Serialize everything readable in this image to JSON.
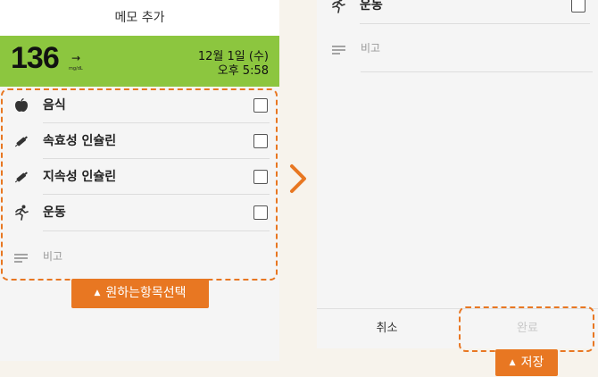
{
  "left_screen": {
    "title": "메모 추가",
    "glucose": {
      "value": "136",
      "trend_arrow": "→",
      "unit": "mg/dL"
    },
    "date": "12월 1일 (수)",
    "time": "오후 5:58",
    "items": [
      {
        "label": "음식",
        "icon": "apple-icon",
        "checked": false
      },
      {
        "label": "속효성 인슐린",
        "icon": "insulin-pen-icon",
        "checked": false
      },
      {
        "label": "지속성 인슐린",
        "icon": "insulin-pen-icon",
        "checked": false
      },
      {
        "label": "운동",
        "icon": "running-icon",
        "checked": false
      }
    ],
    "memo_placeholder": "비고",
    "callout": "원하는항목선택"
  },
  "right_screen": {
    "exercise_label": "운동",
    "memo_placeholder": "비고",
    "cancel_label": "취소",
    "done_label": "완료",
    "callout": "저장"
  },
  "colors": {
    "accent": "#e87722",
    "glucose_bar": "#8cc63f"
  }
}
